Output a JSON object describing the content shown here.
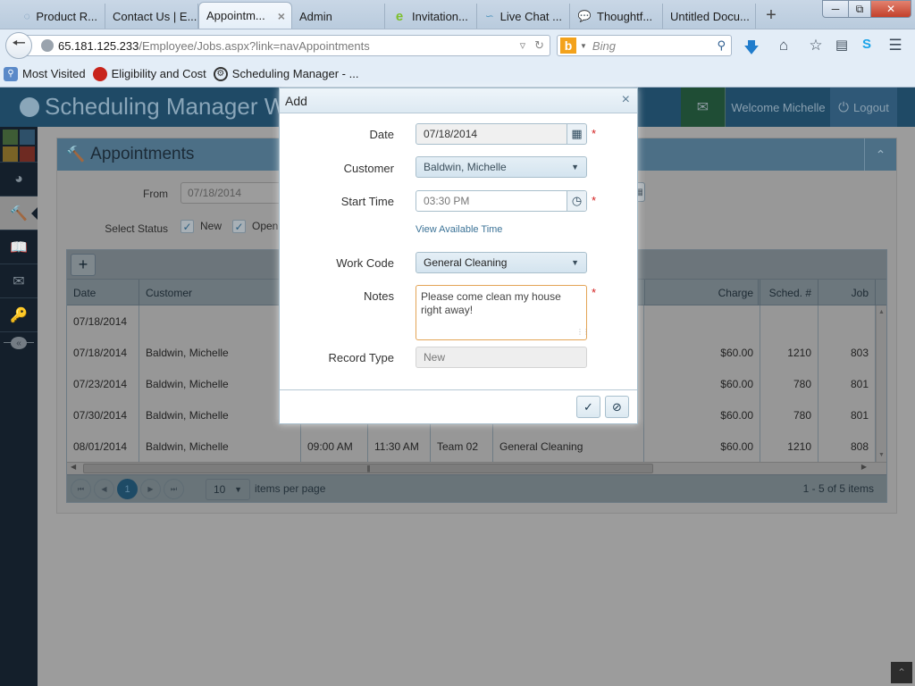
{
  "browser": {
    "tabs": [
      {
        "label": "Product R...",
        "icon": "product-favicon"
      },
      {
        "label": "Contact Us | E...",
        "icon": ""
      },
      {
        "label": "Appointm...",
        "icon": "",
        "active": true
      },
      {
        "label": "Admin",
        "icon": ""
      },
      {
        "label": "Invitation...",
        "icon": "e-favicon"
      },
      {
        "label": "Live Chat ...",
        "icon": "livechat-favicon"
      },
      {
        "label": "Thoughtf...",
        "icon": "speech-bubble-favicon"
      },
      {
        "label": "Untitled Docu...",
        "icon": ""
      }
    ],
    "url_host": "65.181.125.233",
    "url_path": "/Employee/Jobs.aspx?link=navAppointments",
    "search_placeholder": "Bing",
    "bookmarks": [
      {
        "label": "Most Visited",
        "icon": "most-visited-icon"
      },
      {
        "label": "Eligibility and Cost",
        "icon": "apple-icon"
      },
      {
        "label": "Scheduling Manager - ...",
        "icon": "scheduling-icon"
      }
    ]
  },
  "app": {
    "title": "Scheduling Manager We",
    "welcome": "Welcome Michelle",
    "logout": "Logout",
    "panel_title": "Appointments",
    "filters": {
      "from_label": "From",
      "from_value": "07/18/2014",
      "status_label": "Select Status",
      "statuses": [
        {
          "label": "New",
          "checked": true
        },
        {
          "label": "Open",
          "checked": true
        }
      ]
    },
    "grid": {
      "columns": [
        {
          "key": "date",
          "label": "Date"
        },
        {
          "key": "customer",
          "label": "Customer"
        },
        {
          "key": "start",
          "label": ""
        },
        {
          "key": "end",
          "label": ""
        },
        {
          "key": "team",
          "label": ""
        },
        {
          "key": "workcode",
          "label": ""
        },
        {
          "key": "charge",
          "label": "Charge"
        },
        {
          "key": "sched",
          "label": "Sched. #"
        },
        {
          "key": "job",
          "label": "Job"
        }
      ],
      "rows": [
        {
          "date": "07/18/2014",
          "customer": "",
          "start": "",
          "end": "",
          "team": "",
          "workcode": "",
          "charge": "",
          "sched": "",
          "job": ""
        },
        {
          "date": "07/18/2014",
          "customer": "Baldwin, Michelle",
          "start": "",
          "end": "",
          "team": "",
          "workcode": "",
          "charge": "$60.00",
          "sched": "1210",
          "job": "803"
        },
        {
          "date": "07/23/2014",
          "customer": "Baldwin, Michelle",
          "start": "",
          "end": "",
          "team": "",
          "workcode": "",
          "charge": "$60.00",
          "sched": "780",
          "job": "801"
        },
        {
          "date": "07/30/2014",
          "customer": "Baldwin, Michelle",
          "start": "",
          "end": "",
          "team": "",
          "workcode": "",
          "charge": "$60.00",
          "sched": "780",
          "job": "801"
        },
        {
          "date": "08/01/2014",
          "customer": "Baldwin, Michelle",
          "start": "09:00 AM",
          "end": "11:30 AM",
          "team": "Team 02",
          "workcode": "General Cleaning",
          "charge": "$60.00",
          "sched": "1210",
          "job": "808"
        }
      ],
      "pager": {
        "current_page": "1",
        "page_size": "10",
        "page_size_label": "items per page",
        "info": "1 - 5 of 5 items"
      }
    }
  },
  "modal": {
    "title": "Add",
    "fields": {
      "date": {
        "label": "Date",
        "value": "07/18/2014",
        "required": true
      },
      "customer": {
        "label": "Customer",
        "value": "Baldwin, Michelle"
      },
      "start_time": {
        "label": "Start Time",
        "value": "03:30 PM",
        "required": true
      },
      "view_available": "View Available Time",
      "work_code": {
        "label": "Work Code",
        "value": "General Cleaning"
      },
      "notes": {
        "label": "Notes",
        "value": "Please come clean my house right away!",
        "required": true
      },
      "record_type": {
        "label": "Record Type",
        "value": "New"
      }
    },
    "required_mark": "*"
  },
  "colors": {
    "header_bg": "#1f4a66",
    "accent": "#3c7397",
    "required": "#d32020",
    "notes_focus_border": "#e3a456"
  }
}
